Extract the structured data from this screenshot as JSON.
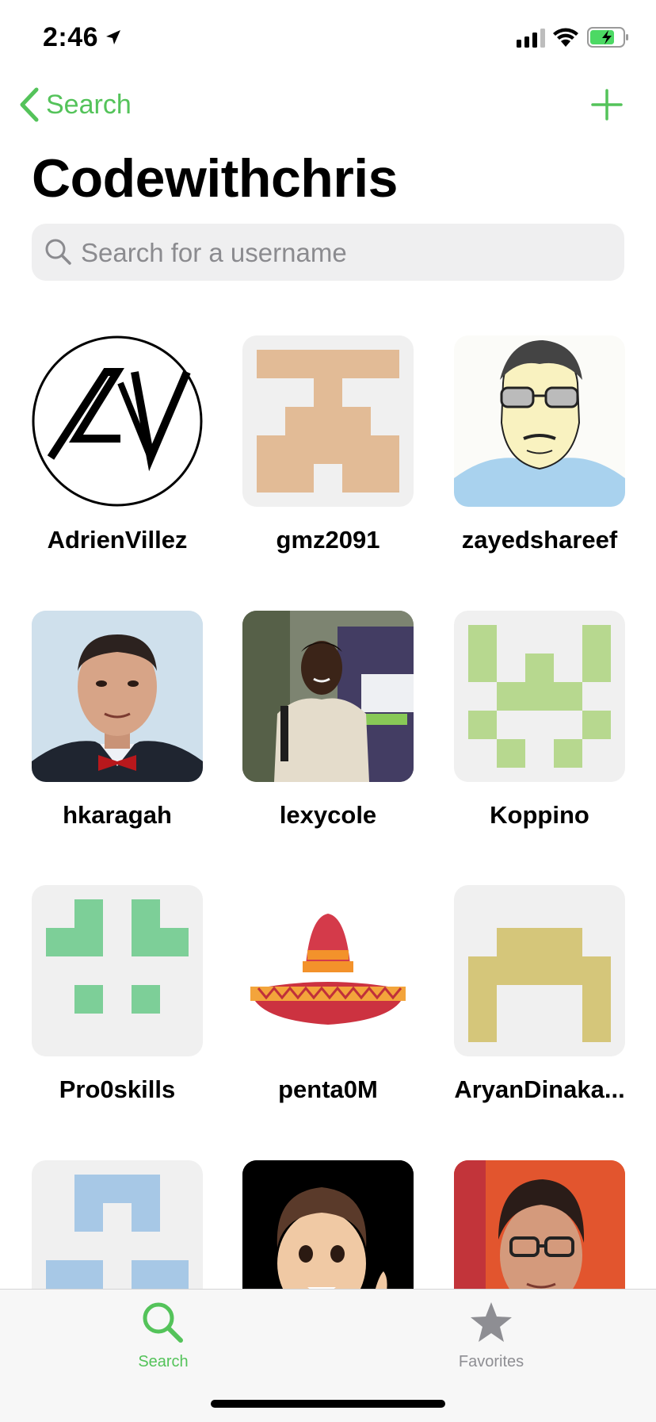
{
  "status_bar": {
    "time": "2:46"
  },
  "nav": {
    "back_label": "Search",
    "add_icon": "plus-icon"
  },
  "page_title": "Codewithchris",
  "search": {
    "placeholder": "Search for a username",
    "value": ""
  },
  "users": [
    {
      "username": "AdrienVillez",
      "avatar": "av-logo"
    },
    {
      "username": "gmz2091",
      "avatar": "identicon-tan"
    },
    {
      "username": "zayedshareef",
      "avatar": "sketch-portrait"
    },
    {
      "username": "hkaragah",
      "avatar": "photo-man-bowtie"
    },
    {
      "username": "lexycole",
      "avatar": "photo-man-banner"
    },
    {
      "username": "Koppino",
      "avatar": "identicon-lightgreen"
    },
    {
      "username": "Pro0skills",
      "avatar": "identicon-green"
    },
    {
      "username": "penta0M",
      "avatar": "sombrero"
    },
    {
      "username": "AryanDinaka...",
      "avatar": "identicon-olive"
    },
    {
      "username": "",
      "avatar": "identicon-blue"
    },
    {
      "username": "",
      "avatar": "memoji"
    },
    {
      "username": "",
      "avatar": "photo-man-glasses"
    }
  ],
  "tabs": [
    {
      "label": "Search",
      "icon": "search-icon",
      "selected": true
    },
    {
      "label": "Favorites",
      "icon": "star-icon",
      "selected": false
    }
  ],
  "colors": {
    "accent": "#54c35a",
    "inactive": "#8e8e93"
  }
}
